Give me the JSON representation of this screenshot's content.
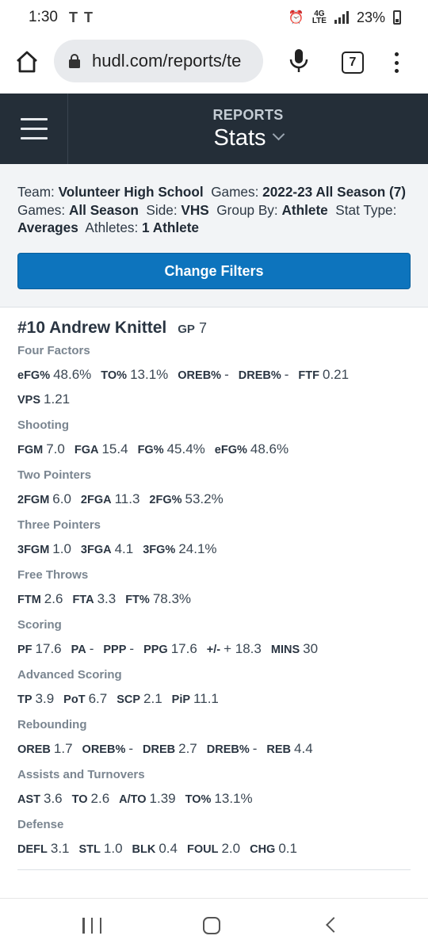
{
  "status_bar": {
    "time": "1:30",
    "notif_glyph_1": "T",
    "notif_glyph_2": "T",
    "battery": "23%",
    "network": "4G LTE"
  },
  "browser": {
    "url": "hudl.com/reports/te",
    "tab_count": "7"
  },
  "header": {
    "kicker": "REPORTS",
    "title": "Stats"
  },
  "filters": {
    "team_label": "Team:",
    "team": "Volunteer High School",
    "games_label": "Games:",
    "games": "2022-23 All Season (7)",
    "games2_label": "Games:",
    "games2": "All Season",
    "side_label": "Side:",
    "side": "VHS",
    "group_label": "Group By:",
    "group": "Athlete",
    "stat_type_label": "Stat Type:",
    "stat_type": "Averages",
    "athletes_label": "Athletes:",
    "athletes": "1 Athlete",
    "button": "Change Filters"
  },
  "athlete": {
    "name": "#10 Andrew Knittel",
    "gp_label": "GP",
    "gp": "7"
  },
  "sections": [
    {
      "title": "Four Factors",
      "stats": [
        {
          "k": "eFG%",
          "v": "48.6%"
        },
        {
          "k": "TO%",
          "v": "13.1%"
        },
        {
          "k": "OREB%",
          "v": "-"
        },
        {
          "k": "DREB%",
          "v": "-"
        },
        {
          "k": "FTF",
          "v": "0.21"
        },
        {
          "k": "VPS",
          "v": "1.21"
        }
      ]
    },
    {
      "title": "Shooting",
      "stats": [
        {
          "k": "FGM",
          "v": "7.0"
        },
        {
          "k": "FGA",
          "v": "15.4"
        },
        {
          "k": "FG%",
          "v": "45.4%"
        },
        {
          "k": "eFG%",
          "v": "48.6%"
        }
      ]
    },
    {
      "title": "Two Pointers",
      "stats": [
        {
          "k": "2FGM",
          "v": "6.0"
        },
        {
          "k": "2FGA",
          "v": "11.3"
        },
        {
          "k": "2FG%",
          "v": "53.2%"
        }
      ]
    },
    {
      "title": "Three Pointers",
      "stats": [
        {
          "k": "3FGM",
          "v": "1.0"
        },
        {
          "k": "3FGA",
          "v": "4.1"
        },
        {
          "k": "3FG%",
          "v": "24.1%"
        }
      ]
    },
    {
      "title": "Free Throws",
      "stats": [
        {
          "k": "FTM",
          "v": "2.6"
        },
        {
          "k": "FTA",
          "v": "3.3"
        },
        {
          "k": "FT%",
          "v": "78.3%"
        }
      ]
    },
    {
      "title": "Scoring",
      "stats": [
        {
          "k": "PF",
          "v": "17.6"
        },
        {
          "k": "PA",
          "v": "-"
        },
        {
          "k": "PPP",
          "v": "-"
        },
        {
          "k": "PPG",
          "v": "17.6"
        },
        {
          "k": "+/-",
          "v": "+ 18.3"
        },
        {
          "k": "MINS",
          "v": "30"
        }
      ]
    },
    {
      "title": "Advanced Scoring",
      "stats": [
        {
          "k": "TP",
          "v": "3.9"
        },
        {
          "k": "PoT",
          "v": "6.7"
        },
        {
          "k": "SCP",
          "v": "2.1"
        },
        {
          "k": "PiP",
          "v": "11.1"
        }
      ]
    },
    {
      "title": "Rebounding",
      "stats": [
        {
          "k": "OREB",
          "v": "1.7"
        },
        {
          "k": "OREB%",
          "v": "-"
        },
        {
          "k": "DREB",
          "v": "2.7"
        },
        {
          "k": "DREB%",
          "v": "-"
        },
        {
          "k": "REB",
          "v": "4.4"
        }
      ]
    },
    {
      "title": "Assists and Turnovers",
      "stats": [
        {
          "k": "AST",
          "v": "3.6"
        },
        {
          "k": "TO",
          "v": "2.6"
        },
        {
          "k": "A/TO",
          "v": "1.39"
        },
        {
          "k": "TO%",
          "v": "13.1%"
        }
      ]
    },
    {
      "title": "Defense",
      "stats": [
        {
          "k": "DEFL",
          "v": "3.1"
        },
        {
          "k": "STL",
          "v": "1.0"
        },
        {
          "k": "BLK",
          "v": "0.4"
        },
        {
          "k": "FOUL",
          "v": "2.0"
        },
        {
          "k": "CHG",
          "v": "0.1"
        }
      ]
    }
  ],
  "icons": {
    "home": "home-icon",
    "lock": "lock-icon",
    "mic": "mic-icon",
    "menu": "more-vert-icon",
    "hamburger": "hamburger-icon",
    "chevron": "chevron-down-icon"
  },
  "colors": {
    "header_bg": "#242e38",
    "button_bg": "#0d74bd",
    "filter_bg": "#f2f4f6"
  }
}
